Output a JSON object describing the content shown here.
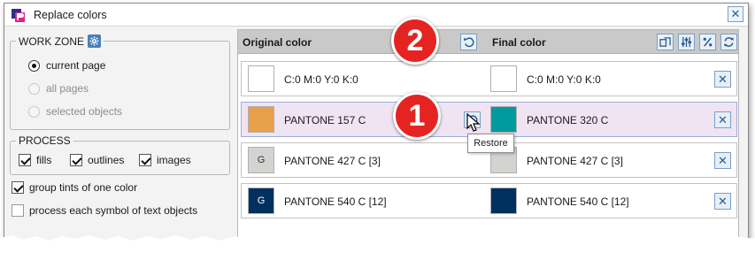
{
  "window": {
    "title": "Replace colors"
  },
  "work_zone": {
    "title": "WORK ZONE",
    "options": [
      {
        "label": "current page",
        "checked": true,
        "enabled": true
      },
      {
        "label": "all pages",
        "checked": false,
        "enabled": false
      },
      {
        "label": "selected objects",
        "checked": false,
        "enabled": false
      }
    ]
  },
  "process": {
    "title": "PROCESS",
    "items": [
      {
        "label": "fills",
        "checked": true
      },
      {
        "label": "outlines",
        "checked": true
      },
      {
        "label": "images",
        "checked": true
      }
    ]
  },
  "options": {
    "group_tints": {
      "label": "group tints of one color",
      "checked": true
    },
    "process_symbols": {
      "label": "process each symbol of text objects",
      "checked": false
    }
  },
  "columns": {
    "original": "Original color",
    "final": "Final color"
  },
  "rows": [
    {
      "orig_name": "C:0 M:0 Y:0 K:0",
      "orig_color": "#ffffff",
      "orig_glyph": "",
      "final_name": "C:0 M:0 Y:0 K:0",
      "final_color": "#ffffff",
      "final_glyph": ""
    },
    {
      "orig_name": "PANTONE 157 C",
      "orig_color": "#e8a04a",
      "orig_glyph": "",
      "final_name": "PANTONE 320 C",
      "final_color": "#009b9f",
      "final_glyph": ""
    },
    {
      "orig_name": "PANTONE 427 C  [3]",
      "orig_color": "#d3d3d1",
      "orig_glyph": "G",
      "final_name": "PANTONE 427 C  [3]",
      "final_color": "#d3d3d1",
      "final_glyph": ""
    },
    {
      "orig_name": "PANTONE 540 C  [12]",
      "orig_color": "#00305e",
      "orig_glyph": "G",
      "final_name": "PANTONE 540 C  [12]",
      "final_color": "#00305e",
      "final_glyph": ""
    }
  ],
  "tooltip": "Restore",
  "badges": {
    "one": "1",
    "two": "2"
  },
  "colors": {
    "accent": "#4a7fb8",
    "selected_row": "#f0e4f2",
    "badge": "#e52421"
  },
  "icons": [
    "app-icon",
    "close-icon",
    "gear-icon",
    "undo-icon",
    "shapes-icon",
    "sliders-icon",
    "percent-icon",
    "refresh-icon",
    "remove-icon",
    "cursor-icon"
  ]
}
